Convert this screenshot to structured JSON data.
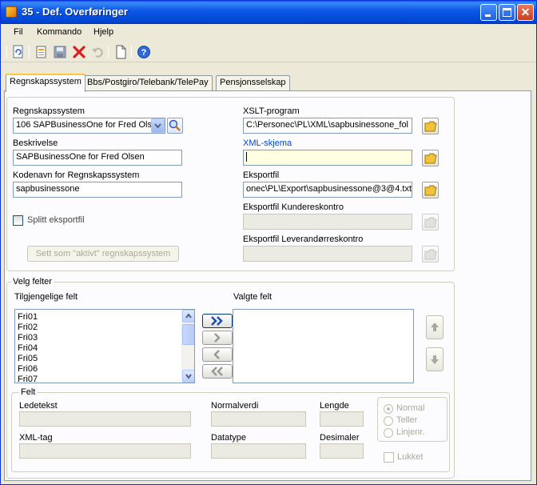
{
  "window": {
    "title": "35 - Def. Overføringer"
  },
  "menu": [
    "Fil",
    "Kommando",
    "Hjelp"
  ],
  "toolbar_icons": [
    "refresh-icon",
    "new-icon",
    "save-icon",
    "delete-icon",
    "undo-icon",
    "blank-page-icon",
    "help-icon"
  ],
  "tabs": [
    "Regnskapssystem",
    "Bbs/Postgiro/Telebank/TelePay",
    "Pensjonsselskap"
  ],
  "left": {
    "regnskapssystem_label": "Regnskapssystem",
    "regnskapssystem_value": "106 SAPBusinessOne for Fred Olse",
    "beskrivelse_label": "Beskrivelse",
    "beskrivelse_value": "SAPBusinessOne for Fred Olsen",
    "kodenavn_label": "Kodenavn for Regnskapssystem",
    "kodenavn_value": "sapbusinessone",
    "splitt_label": "Splitt eksportfil",
    "sett_aktiv_label": "Sett som \"aktivt\" regnskapssystem"
  },
  "right": {
    "xslt_label": "XSLT-program",
    "xslt_value": "C:\\Personec\\PL\\XML\\sapbusinessone_fol",
    "xml_skjema_label": "XML-skjema",
    "xml_skjema_value": "",
    "eksportfil_label": "Eksportfil",
    "eksportfil_value": "onec\\PL\\Export\\sapbusinessone@3@4.txt",
    "kunde_label": "Eksportfil Kundereskontro",
    "kunde_value": "",
    "lev_label": "Eksportfil Leverandørreskontro",
    "lev_value": ""
  },
  "velg_felter": {
    "group_label": "Velg felter",
    "available_label": "Tilgjengelige felt",
    "selected_label": "Valgte felt",
    "available_items": [
      "Fri01",
      "Fri02",
      "Fri03",
      "Fri04",
      "Fri05",
      "Fri06",
      "Fri07"
    ],
    "selected_items": []
  },
  "felt": {
    "group_label": "Felt",
    "ledetekst_label": "Ledetekst",
    "normalverdi_label": "Normalverdi",
    "lengde_label": "Lengde",
    "xml_tag_label": "XML-tag",
    "datatype_label": "Datatype",
    "desimaler_label": "Desimaler",
    "radio_options": [
      "Normal",
      "Teller",
      "Linjenr."
    ],
    "radio_selected": "Normal",
    "lukket_label": "Lukket"
  }
}
